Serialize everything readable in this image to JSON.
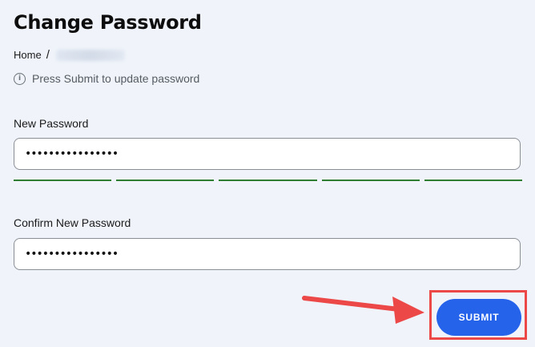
{
  "page": {
    "title": "Change Password"
  },
  "breadcrumb": {
    "home": "Home",
    "separator": "/"
  },
  "hint": {
    "text": "Press Submit to update password"
  },
  "new_password": {
    "label": "New Password",
    "value": "••••••••••••••••"
  },
  "strength_meter": {
    "segments_filled": 5,
    "segments_total": 5,
    "color": "#2e7d32"
  },
  "confirm_password": {
    "label": "Confirm New Password",
    "value": "••••••••••••••••"
  },
  "submit": {
    "label": "SUBMIT",
    "color": "#2563eb"
  },
  "annotation": {
    "color": "#ec4848"
  }
}
